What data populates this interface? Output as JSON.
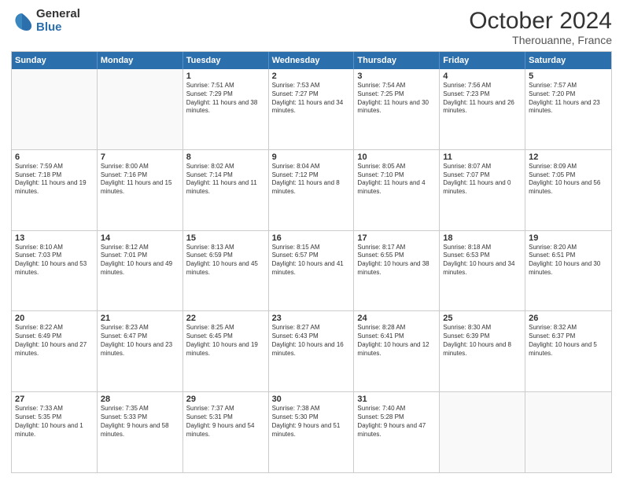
{
  "logo": {
    "general": "General",
    "blue": "Blue"
  },
  "header": {
    "month": "October 2024",
    "location": "Therouanne, France"
  },
  "weekdays": [
    "Sunday",
    "Monday",
    "Tuesday",
    "Wednesday",
    "Thursday",
    "Friday",
    "Saturday"
  ],
  "weeks": [
    [
      {
        "day": "",
        "info": ""
      },
      {
        "day": "",
        "info": ""
      },
      {
        "day": "1",
        "info": "Sunrise: 7:51 AM\nSunset: 7:29 PM\nDaylight: 11 hours and 38 minutes."
      },
      {
        "day": "2",
        "info": "Sunrise: 7:53 AM\nSunset: 7:27 PM\nDaylight: 11 hours and 34 minutes."
      },
      {
        "day": "3",
        "info": "Sunrise: 7:54 AM\nSunset: 7:25 PM\nDaylight: 11 hours and 30 minutes."
      },
      {
        "day": "4",
        "info": "Sunrise: 7:56 AM\nSunset: 7:23 PM\nDaylight: 11 hours and 26 minutes."
      },
      {
        "day": "5",
        "info": "Sunrise: 7:57 AM\nSunset: 7:20 PM\nDaylight: 11 hours and 23 minutes."
      }
    ],
    [
      {
        "day": "6",
        "info": "Sunrise: 7:59 AM\nSunset: 7:18 PM\nDaylight: 11 hours and 19 minutes."
      },
      {
        "day": "7",
        "info": "Sunrise: 8:00 AM\nSunset: 7:16 PM\nDaylight: 11 hours and 15 minutes."
      },
      {
        "day": "8",
        "info": "Sunrise: 8:02 AM\nSunset: 7:14 PM\nDaylight: 11 hours and 11 minutes."
      },
      {
        "day": "9",
        "info": "Sunrise: 8:04 AM\nSunset: 7:12 PM\nDaylight: 11 hours and 8 minutes."
      },
      {
        "day": "10",
        "info": "Sunrise: 8:05 AM\nSunset: 7:10 PM\nDaylight: 11 hours and 4 minutes."
      },
      {
        "day": "11",
        "info": "Sunrise: 8:07 AM\nSunset: 7:07 PM\nDaylight: 11 hours and 0 minutes."
      },
      {
        "day": "12",
        "info": "Sunrise: 8:09 AM\nSunset: 7:05 PM\nDaylight: 10 hours and 56 minutes."
      }
    ],
    [
      {
        "day": "13",
        "info": "Sunrise: 8:10 AM\nSunset: 7:03 PM\nDaylight: 10 hours and 53 minutes."
      },
      {
        "day": "14",
        "info": "Sunrise: 8:12 AM\nSunset: 7:01 PM\nDaylight: 10 hours and 49 minutes."
      },
      {
        "day": "15",
        "info": "Sunrise: 8:13 AM\nSunset: 6:59 PM\nDaylight: 10 hours and 45 minutes."
      },
      {
        "day": "16",
        "info": "Sunrise: 8:15 AM\nSunset: 6:57 PM\nDaylight: 10 hours and 41 minutes."
      },
      {
        "day": "17",
        "info": "Sunrise: 8:17 AM\nSunset: 6:55 PM\nDaylight: 10 hours and 38 minutes."
      },
      {
        "day": "18",
        "info": "Sunrise: 8:18 AM\nSunset: 6:53 PM\nDaylight: 10 hours and 34 minutes."
      },
      {
        "day": "19",
        "info": "Sunrise: 8:20 AM\nSunset: 6:51 PM\nDaylight: 10 hours and 30 minutes."
      }
    ],
    [
      {
        "day": "20",
        "info": "Sunrise: 8:22 AM\nSunset: 6:49 PM\nDaylight: 10 hours and 27 minutes."
      },
      {
        "day": "21",
        "info": "Sunrise: 8:23 AM\nSunset: 6:47 PM\nDaylight: 10 hours and 23 minutes."
      },
      {
        "day": "22",
        "info": "Sunrise: 8:25 AM\nSunset: 6:45 PM\nDaylight: 10 hours and 19 minutes."
      },
      {
        "day": "23",
        "info": "Sunrise: 8:27 AM\nSunset: 6:43 PM\nDaylight: 10 hours and 16 minutes."
      },
      {
        "day": "24",
        "info": "Sunrise: 8:28 AM\nSunset: 6:41 PM\nDaylight: 10 hours and 12 minutes."
      },
      {
        "day": "25",
        "info": "Sunrise: 8:30 AM\nSunset: 6:39 PM\nDaylight: 10 hours and 8 minutes."
      },
      {
        "day": "26",
        "info": "Sunrise: 8:32 AM\nSunset: 6:37 PM\nDaylight: 10 hours and 5 minutes."
      }
    ],
    [
      {
        "day": "27",
        "info": "Sunrise: 7:33 AM\nSunset: 5:35 PM\nDaylight: 10 hours and 1 minute."
      },
      {
        "day": "28",
        "info": "Sunrise: 7:35 AM\nSunset: 5:33 PM\nDaylight: 9 hours and 58 minutes."
      },
      {
        "day": "29",
        "info": "Sunrise: 7:37 AM\nSunset: 5:31 PM\nDaylight: 9 hours and 54 minutes."
      },
      {
        "day": "30",
        "info": "Sunrise: 7:38 AM\nSunset: 5:30 PM\nDaylight: 9 hours and 51 minutes."
      },
      {
        "day": "31",
        "info": "Sunrise: 7:40 AM\nSunset: 5:28 PM\nDaylight: 9 hours and 47 minutes."
      },
      {
        "day": "",
        "info": ""
      },
      {
        "day": "",
        "info": ""
      }
    ]
  ]
}
